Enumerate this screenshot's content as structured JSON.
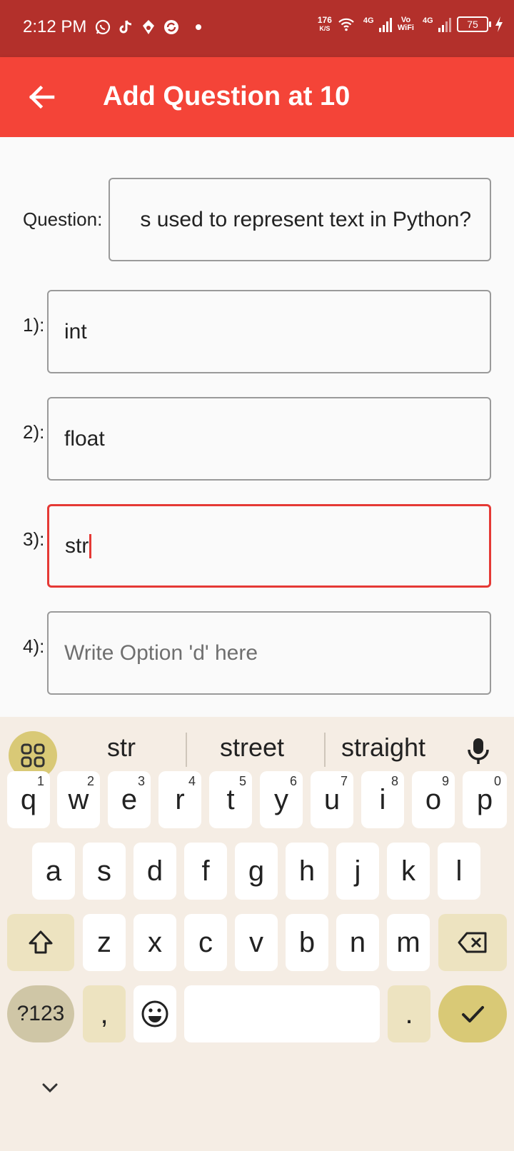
{
  "status_bar": {
    "time": "2:12 PM",
    "net_speed_value": "176",
    "net_speed_unit": "K/S",
    "sim1_label": "4G",
    "vowifi_top": "Vo",
    "vowifi_bottom": "WiFi",
    "sim2_label": "4G",
    "battery_level": "75",
    "left_icons": [
      "whatsapp-icon",
      "tiktok-icon",
      "music-note-icon",
      "sync-app-icon"
    ],
    "right_icons": [
      "wifi-icon",
      "signal-icon",
      "signal-icon",
      "battery-icon",
      "charging-bolt-icon"
    ]
  },
  "app_bar": {
    "title": "Add Question at 10",
    "back_icon": "arrow-back-icon",
    "color": "#f44438"
  },
  "form": {
    "question_label": "Question:",
    "question_value": "s used to represent text in Python?",
    "options": [
      {
        "label": "1):",
        "value": "int",
        "placeholder": ""
      },
      {
        "label": "2):",
        "value": "float",
        "placeholder": ""
      },
      {
        "label": "3):",
        "value": "str",
        "placeholder": "",
        "focused": true
      },
      {
        "label": "4):",
        "value": "",
        "placeholder": "Write Option 'd' here"
      }
    ],
    "focus_color": "#e53935"
  },
  "keyboard": {
    "suggestions": [
      "str",
      "street",
      "straight"
    ],
    "row1": [
      {
        "key": "q",
        "hint": "1"
      },
      {
        "key": "w",
        "hint": "2"
      },
      {
        "key": "e",
        "hint": "3"
      },
      {
        "key": "r",
        "hint": "4"
      },
      {
        "key": "t",
        "hint": "5"
      },
      {
        "key": "y",
        "hint": "6"
      },
      {
        "key": "u",
        "hint": "7"
      },
      {
        "key": "i",
        "hint": "8"
      },
      {
        "key": "o",
        "hint": "9"
      },
      {
        "key": "p",
        "hint": "0"
      }
    ],
    "row2": [
      "a",
      "s",
      "d",
      "f",
      "g",
      "h",
      "j",
      "k",
      "l"
    ],
    "row3": [
      "z",
      "x",
      "c",
      "v",
      "b",
      "n",
      "m"
    ],
    "symbols_label": "?123",
    "comma": ",",
    "period": ".",
    "accent_color": "#d9c976"
  }
}
